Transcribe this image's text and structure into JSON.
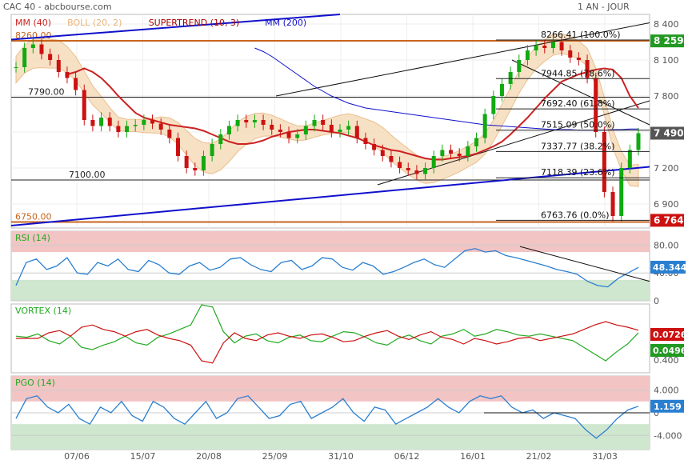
{
  "header": {
    "title": "CAC 40 - abcbourse.com",
    "period": "1 AN - JOUR"
  },
  "colors": {
    "mm40": "#cc2222",
    "boll": "#e8b47a",
    "boll_fill": "#f6dcbc",
    "supertrend": "#aa0000",
    "mm200": "#1010cc",
    "candle_up": "#11aa11",
    "candle_down": "#cc1111",
    "orange_line": "#c8641e",
    "rsi": "#2a7fd0",
    "vortex_plus": "#22aa22",
    "vortex_minus": "#cc1111",
    "pgo": "#2a7fd0",
    "zone_red": "#f2c4c4",
    "zone_green": "#cfe6cf",
    "price_tag": "#555555"
  },
  "chart_data": [
    {
      "type": "candlestick",
      "name": "CAC 40",
      "legend": [
        {
          "label": "MM (40)",
          "color": "#cc2222"
        },
        {
          "label": "BOLL (20, 2)",
          "color": "#e8b47a"
        },
        {
          "label": "SUPERTREND (10, 3)",
          "color": "#aa0000"
        },
        {
          "label": "MM (200)",
          "color": "#1010cc"
        }
      ],
      "x_ticks": [
        "07/06",
        "15/07",
        "20/08",
        "25/09",
        "31/10",
        "06/12",
        "16/01",
        "21/02",
        "31/03"
      ],
      "y_ticks": [
        "8 400",
        "8 100",
        "7 800",
        "7 500",
        "7 200",
        "6 900"
      ],
      "ylim": [
        6700,
        8480
      ],
      "horizontal_levels": [
        {
          "label": "8260.00",
          "value": 8260
        },
        {
          "label": "7790.00",
          "value": 7790
        },
        {
          "label": "7100.00",
          "value": 7100
        },
        {
          "label": "6750.00",
          "value": 6750
        }
      ],
      "fibonacci": [
        {
          "label": "8266.41 (100.0%)",
          "value": 8266.41
        },
        {
          "label": "7944.85 (78.6%)",
          "value": 7944.85
        },
        {
          "label": "7692.40 (61.8%)",
          "value": 7692.4
        },
        {
          "label": "7515.09 (50.0%)",
          "value": 7515.09
        },
        {
          "label": "7337.77 (38.2%)",
          "value": 7337.77
        },
        {
          "label": "7118.39 (23.6%)",
          "value": 7118.39
        },
        {
          "label": "6763.76 (0.0%)",
          "value": 6763.76
        }
      ],
      "price_tags": [
        {
          "label": "8 259",
          "value": 8259,
          "color": "#229922"
        },
        {
          "label": "7 490",
          "value": 7490,
          "color": "#555555"
        },
        {
          "label": "6 764",
          "value": 6764,
          "color": "#cc1111"
        }
      ],
      "close_series": [
        8040,
        8200,
        8230,
        8150,
        8100,
        8000,
        7950,
        7850,
        7600,
        7550,
        7620,
        7550,
        7500,
        7550,
        7560,
        7600,
        7570,
        7520,
        7450,
        7300,
        7200,
        7180,
        7300,
        7400,
        7480,
        7550,
        7600,
        7580,
        7600,
        7560,
        7520,
        7500,
        7450,
        7480,
        7550,
        7600,
        7560,
        7500,
        7520,
        7550,
        7450,
        7400,
        7350,
        7300,
        7250,
        7200,
        7180,
        7150,
        7200,
        7300,
        7350,
        7320,
        7300,
        7380,
        7450,
        7650,
        7800,
        7900,
        8000,
        8100,
        8180,
        8220,
        8200,
        8250,
        8180,
        8120,
        8100,
        7950,
        7500,
        7000,
        6800,
        7200,
        7350,
        7490
      ],
      "mm40_series": [
        7980,
        8000,
        8030,
        8000,
        7950,
        7880,
        7800,
        7730,
        7660,
        7620,
        7600,
        7580,
        7560,
        7550,
        7540,
        7530,
        7510,
        7480,
        7450,
        7420,
        7400,
        7400,
        7410,
        7430,
        7460,
        7480,
        7500,
        7510,
        7520,
        7520,
        7510,
        7500,
        7490,
        7470,
        7450,
        7420,
        7390,
        7370,
        7350,
        7340,
        7320,
        7300,
        7280,
        7270,
        7270,
        7280,
        7290,
        7300,
        7320,
        7350,
        7380,
        7420,
        7480,
        7550,
        7620,
        7700,
        7780,
        7850,
        7920,
        7950,
        7980,
        8000,
        8020,
        8030,
        8020,
        7950,
        7800,
        7700
      ],
      "mm200_series": [
        8200,
        8170,
        8130,
        8080,
        8030,
        7980,
        7930,
        7880,
        7840,
        7800,
        7770,
        7740,
        7720,
        7700,
        7690,
        7680,
        7670,
        7660,
        7650,
        7640,
        7630,
        7620,
        7610,
        7600,
        7590,
        7580,
        7570,
        7560,
        7555,
        7550,
        7545,
        7540,
        7535,
        7530,
        7525,
        7520,
        7520,
        7520,
        7515,
        7515,
        7515,
        7515,
        7520,
        7520,
        7525,
        7525
      ]
    },
    {
      "type": "line",
      "name": "RSI (14)",
      "y_ticks": [
        "80.00",
        "40.00",
        "0"
      ],
      "ylim": [
        0,
        100
      ],
      "zones": {
        "overbought": 70,
        "oversold": 30
      },
      "value_tag": "48.344",
      "values": [
        22,
        55,
        60,
        45,
        50,
        62,
        40,
        38,
        55,
        50,
        60,
        45,
        42,
        58,
        52,
        40,
        38,
        50,
        55,
        44,
        48,
        60,
        62,
        52,
        45,
        42,
        55,
        58,
        45,
        50,
        62,
        60,
        48,
        44,
        55,
        50,
        38,
        42,
        48,
        55,
        60,
        52,
        48,
        60,
        72,
        75,
        70,
        72,
        65,
        62,
        58,
        54,
        50,
        45,
        42,
        38,
        28,
        22,
        20,
        32,
        40,
        48
      ]
    },
    {
      "type": "line",
      "name": "VORTEX (14)",
      "y_ticks": [
        "0.400"
      ],
      "value_tags": [
        {
          "label": "0.0726",
          "color": "#cc1111"
        },
        {
          "label": "0.0496",
          "color": "#229922"
        }
      ],
      "series": [
        {
          "values": [
            0.02,
            0.01,
            0.04,
            -0.02,
            -0.05,
            0.02,
            -0.08,
            -0.1,
            -0.06,
            -0.03,
            0.02,
            -0.04,
            -0.06,
            0.01,
            0.04,
            0.08,
            0.12,
            0.3,
            0.28,
            0.06,
            -0.04,
            0.02,
            0.04,
            -0.02,
            -0.04,
            0.01,
            0.03,
            -0.02,
            -0.03,
            0.02,
            0.06,
            0.05,
            0.01,
            -0.04,
            -0.06,
            0.0,
            0.03,
            -0.02,
            -0.05,
            0.02,
            0.04,
            0.08,
            0.02,
            0.04,
            0.08,
            0.06,
            0.03,
            0.02,
            0.04,
            0.02,
            0.0,
            -0.02,
            -0.08,
            -0.14,
            -0.2,
            -0.12,
            -0.05,
            0.0496
          ]
        },
        {
          "values": [
            0.0,
            0.0,
            0.0,
            0.05,
            0.07,
            0.02,
            0.1,
            0.12,
            0.08,
            0.06,
            0.02,
            0.06,
            0.08,
            0.03,
            0.0,
            -0.02,
            -0.06,
            -0.2,
            -0.22,
            -0.04,
            0.05,
            0.0,
            -0.02,
            0.03,
            0.05,
            0.02,
            0.0,
            0.03,
            0.04,
            0.01,
            -0.03,
            -0.02,
            0.02,
            0.05,
            0.07,
            0.02,
            -0.01,
            0.03,
            0.06,
            0.01,
            -0.01,
            -0.05,
            0.0,
            -0.02,
            -0.05,
            -0.03,
            0.0,
            0.01,
            -0.02,
            0.0,
            0.02,
            0.04,
            0.08,
            0.12,
            0.15,
            0.12,
            0.1,
            0.0726
          ]
        }
      ]
    },
    {
      "type": "line",
      "name": "PGO (14)",
      "y_ticks": [
        "4.000",
        "0",
        "-4.000"
      ],
      "ylim": [
        -6.5,
        6.5
      ],
      "zones": {
        "overbought": 2,
        "oversold": -2
      },
      "value_tag": "1.159",
      "values": [
        -1,
        2.5,
        3,
        1,
        0,
        1.5,
        -1,
        -2,
        1,
        0,
        2,
        -0.5,
        -1.5,
        2,
        1,
        -1,
        -2,
        0,
        2,
        -1,
        0,
        2.5,
        3,
        1,
        -1,
        -0.5,
        1.5,
        2,
        -1,
        0,
        1,
        2.5,
        0,
        -1.5,
        1,
        0.5,
        -2,
        -1,
        0,
        1,
        2.5,
        1,
        0,
        2,
        3,
        2.5,
        3,
        1,
        0,
        0.5,
        -1,
        0,
        -0.5,
        -1,
        -3,
        -4.5,
        -3,
        -1,
        0.5,
        1.159
      ]
    }
  ]
}
